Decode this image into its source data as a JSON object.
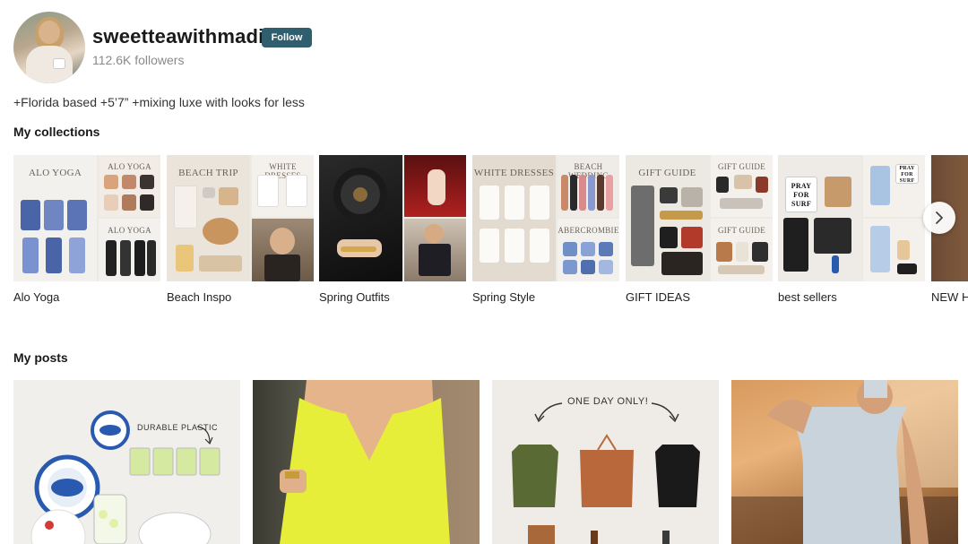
{
  "profile": {
    "username": "sweetteawithmadi",
    "follow_label": "Follow",
    "followers": "112.6K followers",
    "bio": "+Florida based +5’7” +mixing luxe with looks for less"
  },
  "collections_section": {
    "title": "My collections",
    "items": [
      {
        "label": "Alo Yoga",
        "caption_main": "ALO YOGA",
        "caption_tr": "ALO YOGA",
        "caption_br": "ALO YOGA"
      },
      {
        "label": "Beach Inspo",
        "caption_main": "BEACH TRIP",
        "caption_tr": "WHITE DRESSES"
      },
      {
        "label": "Spring Outfits"
      },
      {
        "label": "Spring Style",
        "caption_main": "WHITE DRESSES",
        "caption_tr": "BEACH WEDDING",
        "caption_br": "ABERCROMBIE"
      },
      {
        "label": "GIFT IDEAS",
        "caption_main": "GIFT GUIDE",
        "caption_tr": "GIFT GUIDE",
        "caption_br": "GIFT GUIDE"
      },
      {
        "label": "best sellers",
        "caption_main": "PRAY FOR SURF",
        "caption_tr": "PRAY FOR SURF"
      },
      {
        "label": "NEW H"
      }
    ],
    "next_icon": "chevron-right-icon"
  },
  "posts_section": {
    "title": "My posts",
    "posts": [
      {
        "caption": "DURABLE PLASTIC"
      },
      {
        "caption": ""
      },
      {
        "caption": "ONE DAY ONLY!"
      },
      {
        "caption": ""
      }
    ]
  },
  "colors": {
    "follow_button": "#2f5f6e",
    "muted_text": "#8a8a8a"
  }
}
